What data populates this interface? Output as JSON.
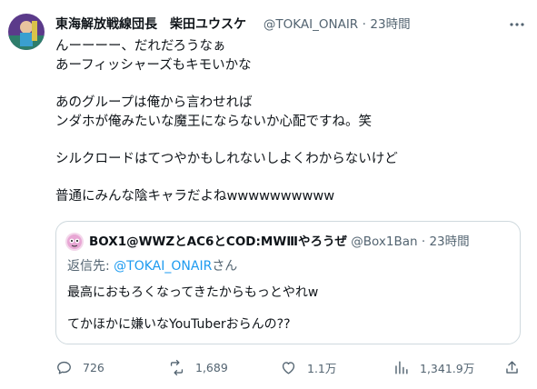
{
  "tweet": {
    "author_name": "東海解放戦線団長　柴田ユウスケ",
    "handle": "@TOKAI_ONAIR",
    "separator": "·",
    "time": "23時間",
    "lines": [
      "んーーーー、だれだろうなぁ",
      "あーフィッシャーズもキモいかな",
      "",
      "あのグループは俺から言わせれば",
      "ンダホが俺みたいな魔王にならないか心配ですね。笑",
      "",
      "シルクロードはてつやかもしれないしよくわからないけど",
      "",
      "普通にみんな陰キャラだよねwwwwwwwwww"
    ]
  },
  "quote": {
    "author_name": "BOX1@WWZとAC6とCOD:MWⅢやろうぜ",
    "handle": "@Box1Ban",
    "separator": "·",
    "time": "23時間",
    "reply_prefix": "返信先: ",
    "reply_mention": "@TOKAI_ONAIR",
    "reply_suffix": "さん",
    "line1": "最高におもろくなってきたからもっとやれw",
    "line2": "てかほかに嫌いなYouTuberおらんの??"
  },
  "actions": {
    "replies": "726",
    "retweets": "1,689",
    "likes": "1.1万",
    "views": "1,341.9万"
  },
  "colors": {
    "text": "#0f1419",
    "secondary": "#536471",
    "link": "#1d9bf0",
    "border": "#cfd9de"
  }
}
